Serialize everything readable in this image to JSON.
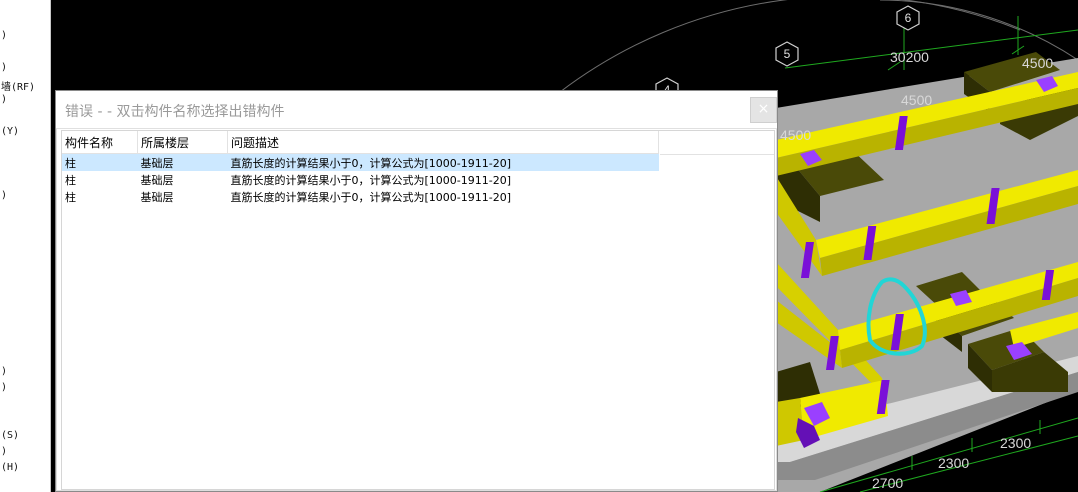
{
  "left_panel": {
    "fragments": [
      ")",
      ")",
      "墙(RF)",
      ")",
      "(Y)",
      ")",
      ")",
      ")",
      "(S)",
      ")",
      "(H)"
    ]
  },
  "dialog": {
    "title": "错误 - - 双击构件名称选择出错构件",
    "close_label": "×",
    "columns": [
      "构件名称",
      "所属楼层",
      "问题描述"
    ],
    "rows": [
      {
        "name": "柱",
        "floor": "基础层",
        "desc": "直筋长度的计算结果小于0，计算公式为[1000-1911-20]",
        "selected": true
      },
      {
        "name": "柱",
        "floor": "基础层",
        "desc": "直筋长度的计算结果小于0，计算公式为[1000-1911-20]",
        "selected": false
      },
      {
        "name": "柱",
        "floor": "基础层",
        "desc": "直筋长度的计算结果小于0，计算公式为[1000-1911-20]",
        "selected": false
      }
    ]
  },
  "viewport": {
    "axis_labels": [
      "4",
      "5",
      "6"
    ],
    "dimensions": [
      "30200",
      "4500",
      "4500",
      "4500",
      "2300",
      "2300",
      "2700"
    ],
    "colors": {
      "wall": "#e8e200",
      "footing": "#3a3a05",
      "column": "#7a10d8",
      "slab": "#a8a8a8",
      "dimension_line": "#1fa81f",
      "highlight": "#21d6d6"
    }
  }
}
